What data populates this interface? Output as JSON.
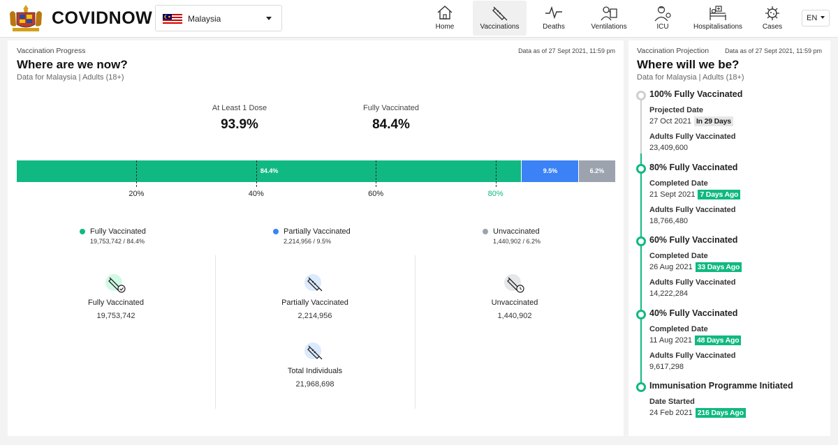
{
  "header": {
    "brand": "COVIDNOW",
    "country": "Malaysia",
    "language": "EN",
    "nav": [
      {
        "label": "Home",
        "icon": "home-icon"
      },
      {
        "label": "Vaccinations",
        "icon": "syringe-icon",
        "active": true
      },
      {
        "label": "Deaths",
        "icon": "pulse-icon"
      },
      {
        "label": "Ventilations",
        "icon": "ventilator-icon"
      },
      {
        "label": "ICU",
        "icon": "icu-icon"
      },
      {
        "label": "Hospitalisations",
        "icon": "hospital-bed-icon"
      },
      {
        "label": "Cases",
        "icon": "virus-icon"
      }
    ]
  },
  "progress": {
    "section_label": "Vaccination Progress",
    "as_of": "Data as of 27 Sept 2021, 11:59 pm",
    "title": "Where are we now?",
    "subtitle": "Data for Malaysia | Adults (18+)",
    "at_least_one_label": "At Least 1 Dose",
    "at_least_one_value": "93.9%",
    "fully_label": "Fully Vaccinated",
    "fully_value": "84.4%"
  },
  "chart_data": {
    "type": "bar",
    "orientation": "horizontal-stacked",
    "series": [
      {
        "name": "Fully Vaccinated",
        "value": 84.4,
        "label": "84.4%",
        "color": "#10b981"
      },
      {
        "name": "Partially Vaccinated",
        "value": 9.5,
        "label": "9.5%",
        "color": "#3b82f6"
      },
      {
        "name": "Unvaccinated",
        "value": 6.2,
        "label": "6.2%",
        "color": "#9ca3af"
      }
    ],
    "ticks": [
      {
        "value": 20,
        "label": "20%"
      },
      {
        "value": 40,
        "label": "40%"
      },
      {
        "value": 60,
        "label": "60%"
      },
      {
        "value": 80,
        "label": "80%",
        "highlight": true
      }
    ],
    "xlim": [
      0,
      100
    ]
  },
  "legend": [
    {
      "name": "Fully Vaccinated",
      "detail": "19,753,742 / 84.4%",
      "color": "#10b981"
    },
    {
      "name": "Partially Vaccinated",
      "detail": "2,214,956 / 9.5%",
      "color": "#3b82f6"
    },
    {
      "name": "Unvaccinated",
      "detail": "1,440,902 / 6.2%",
      "color": "#9ca3af"
    }
  ],
  "cards": {
    "fully": {
      "title": "Fully Vaccinated",
      "value": "19,753,742"
    },
    "partial": {
      "title": "Partially Vaccinated",
      "value": "2,214,956"
    },
    "unvax": {
      "title": "Unvaccinated",
      "value": "1,440,902"
    },
    "total": {
      "title": "Total Individuals",
      "value": "21,968,698"
    }
  },
  "projection": {
    "section_label": "Vaccination Projection",
    "as_of": "Data as of 27 Sept 2021, 11:59 pm",
    "title": "Where will we be?",
    "subtitle": "Data for Malaysia | Adults (18+)",
    "milestones": [
      {
        "title": "100% Fully Vaccinated",
        "date_key": "Projected Date",
        "date": "27 Oct 2021",
        "badge": "In 29 Days",
        "count_key": "Adults Fully Vaccinated",
        "count": "23,409,600"
      },
      {
        "title": "80% Fully Vaccinated",
        "date_key": "Completed Date",
        "date": "21 Sept 2021",
        "badge": "7 Days Ago",
        "count_key": "Adults Fully Vaccinated",
        "count": "18,766,480"
      },
      {
        "title": "60% Fully Vaccinated",
        "date_key": "Completed Date",
        "date": "26 Aug 2021",
        "badge": "33 Days Ago",
        "count_key": "Adults Fully Vaccinated",
        "count": "14,222,284"
      },
      {
        "title": "40% Fully Vaccinated",
        "date_key": "Completed Date",
        "date": "11 Aug 2021",
        "badge": "48 Days Ago",
        "count_key": "Adults Fully Vaccinated",
        "count": "9,617,298"
      },
      {
        "title": "Immunisation Programme Initiated",
        "date_key": "Date Started",
        "date": "24 Feb 2021",
        "badge": "216 Days Ago"
      }
    ]
  }
}
